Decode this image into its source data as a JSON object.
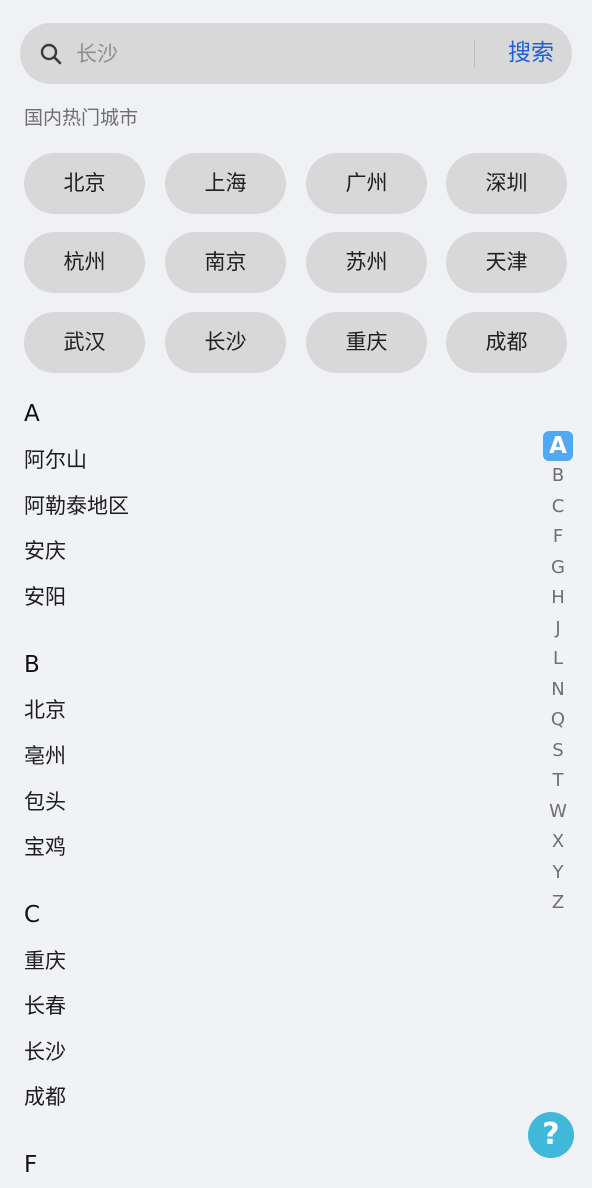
{
  "search": {
    "placeholder": "长沙",
    "value": "",
    "button_label": "搜索"
  },
  "hot_cities": {
    "title": "国内热门城市",
    "items": [
      "北京",
      "上海",
      "广州",
      "深圳",
      "杭州",
      "南京",
      "苏州",
      "天津",
      "武汉",
      "长沙",
      "重庆",
      "成都"
    ]
  },
  "groups": [
    {
      "letter": "A",
      "cities": [
        "阿尔山",
        "阿勒泰地区",
        "安庆",
        "安阳"
      ]
    },
    {
      "letter": "B",
      "cities": [
        "北京",
        "亳州",
        "包头",
        "宝鸡"
      ]
    },
    {
      "letter": "C",
      "cities": [
        "重庆",
        "长春",
        "长沙",
        "成都"
      ]
    },
    {
      "letter": "F",
      "cities": []
    }
  ],
  "index_bar": {
    "letters": [
      "A",
      "B",
      "C",
      "F",
      "G",
      "H",
      "J",
      "L",
      "N",
      "Q",
      "S",
      "T",
      "W",
      "X",
      "Y",
      "Z"
    ],
    "active": "A"
  },
  "help_button": {
    "label": "?"
  },
  "colors": {
    "accent": "#1f5fd8",
    "index_active": "#52a8f2",
    "help_button": "#3fb8d9",
    "chip_background": "#d8d8d8"
  }
}
